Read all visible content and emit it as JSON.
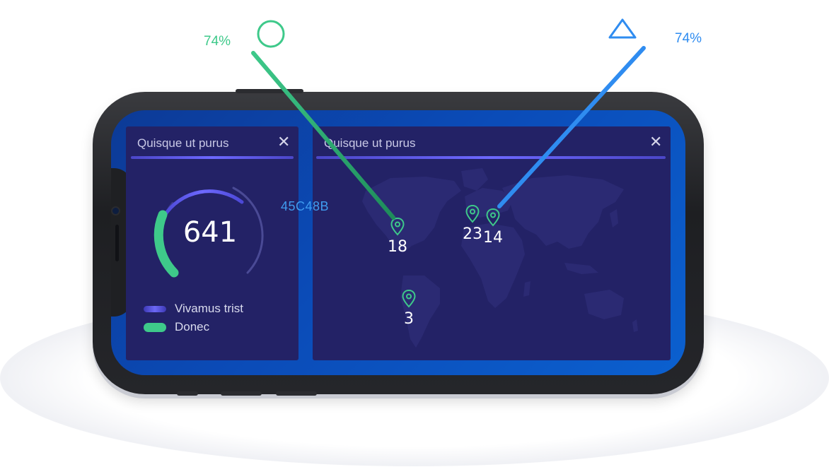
{
  "widgets": {
    "gauge_card": {
      "title": "Quisque ut purus",
      "close_icon": "close-icon"
    },
    "map_card": {
      "title": "Quisque ut purus",
      "close_icon": "close-icon"
    }
  },
  "gauge": {
    "value": "641",
    "legend": [
      {
        "label": "Vivamus trist",
        "color": "#5b57e0"
      },
      {
        "label": "Donec",
        "color": "#3ec98a"
      }
    ]
  },
  "map_markers": [
    {
      "label": "18",
      "icon": "map-pin-icon"
    },
    {
      "label": "23",
      "icon": "map-pin-icon"
    },
    {
      "label": "14",
      "icon": "map-pin-icon"
    },
    {
      "label": "3",
      "icon": "map-pin-icon"
    }
  ],
  "annotations": {
    "left": {
      "percent": "74%",
      "shape": "circle-icon",
      "color": "#3ec98a"
    },
    "right": {
      "percent": "74%",
      "shape": "triangle-icon",
      "color": "#2f8cf0"
    },
    "hex_code": "45C48B"
  },
  "colors": {
    "screen_bg": "#0b4bb7",
    "card_bg": "#232266",
    "accent_purple": "#5b57e0",
    "accent_green": "#3ec98a",
    "accent_blue": "#2f8cf0"
  }
}
